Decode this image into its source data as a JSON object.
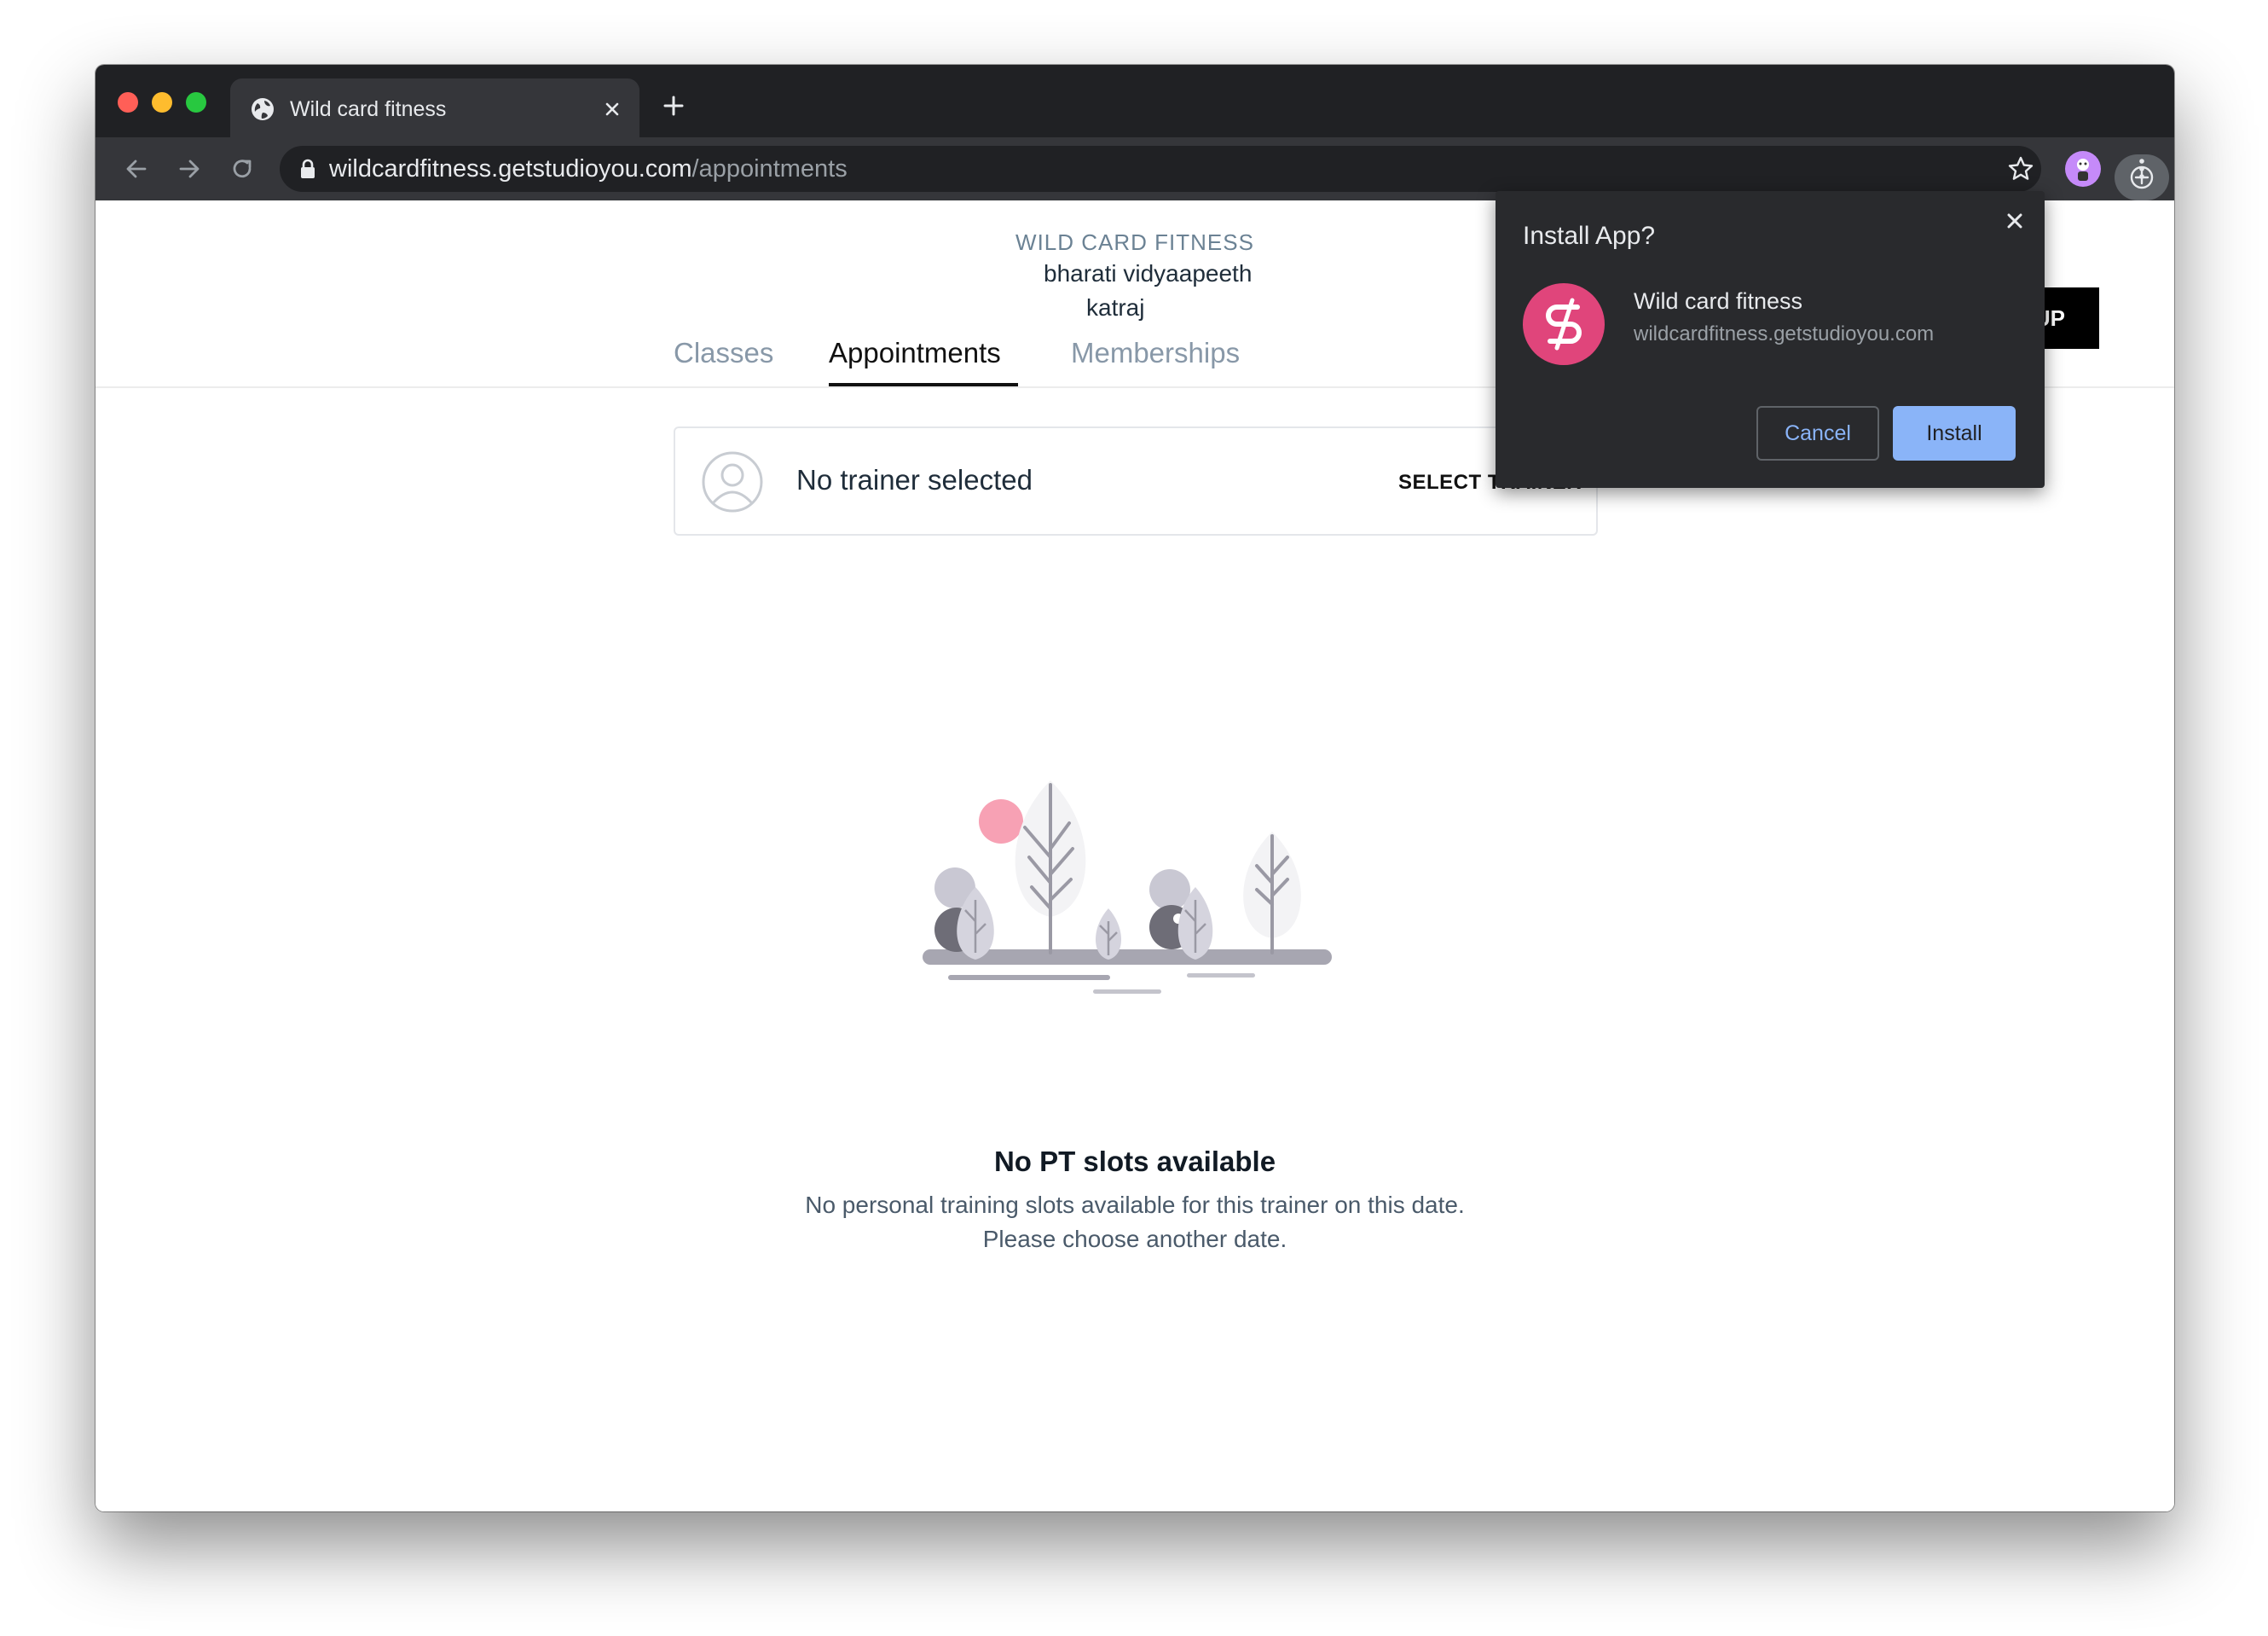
{
  "browser": {
    "tab": {
      "title": "Wild card fitness",
      "favicon": "globe-icon"
    },
    "url": {
      "host": "wildcardfitness.getstudioyou.com",
      "path": "/appointments"
    }
  },
  "header": {
    "studio_name": "WILD CARD FITNESS",
    "address_line1": "bharati vidyaapeeth",
    "address_line2": "katraj",
    "signup_label_fragment": "UP"
  },
  "nav": {
    "tabs": [
      {
        "label": "Classes",
        "active": false
      },
      {
        "label": "Appointments",
        "active": true
      },
      {
        "label": "Memberships",
        "active": false
      }
    ]
  },
  "trainer": {
    "status": "No trainer selected",
    "select_label": "SELECT TRAINER"
  },
  "empty_state": {
    "title": "No PT slots available",
    "line1": "No personal training slots available for this trainer on this date.",
    "line2": "Please choose another date."
  },
  "install_popup": {
    "title": "Install App?",
    "app_name": "Wild card fitness",
    "origin": "wildcardfitness.getstudioyou.com",
    "cancel_label": "Cancel",
    "install_label": "Install",
    "icon_color": "#e0457b"
  }
}
